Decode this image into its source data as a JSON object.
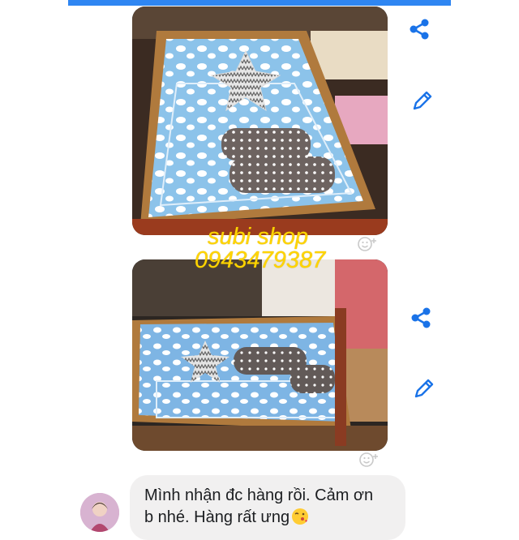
{
  "colors": {
    "accent": "#2f86f2",
    "icon_blue": "#1a73e8",
    "watermark": "#ffd400",
    "bubble": "#f1f0f0"
  },
  "watermark": {
    "shop": "subi shop",
    "phone": "0943479387"
  },
  "photos": [
    {
      "name": "crib-photo-top-down"
    },
    {
      "name": "crib-photo-side-view"
    }
  ],
  "icons": {
    "share": "share-icon",
    "edit": "pencil-icon",
    "react": "add-reaction-icon"
  },
  "message": {
    "line1": "Mình nhận đc hàng rồi. Cảm ơn",
    "line2": "b nhé. Hàng rất ưng",
    "emoji": "kissing-face-emoji"
  }
}
